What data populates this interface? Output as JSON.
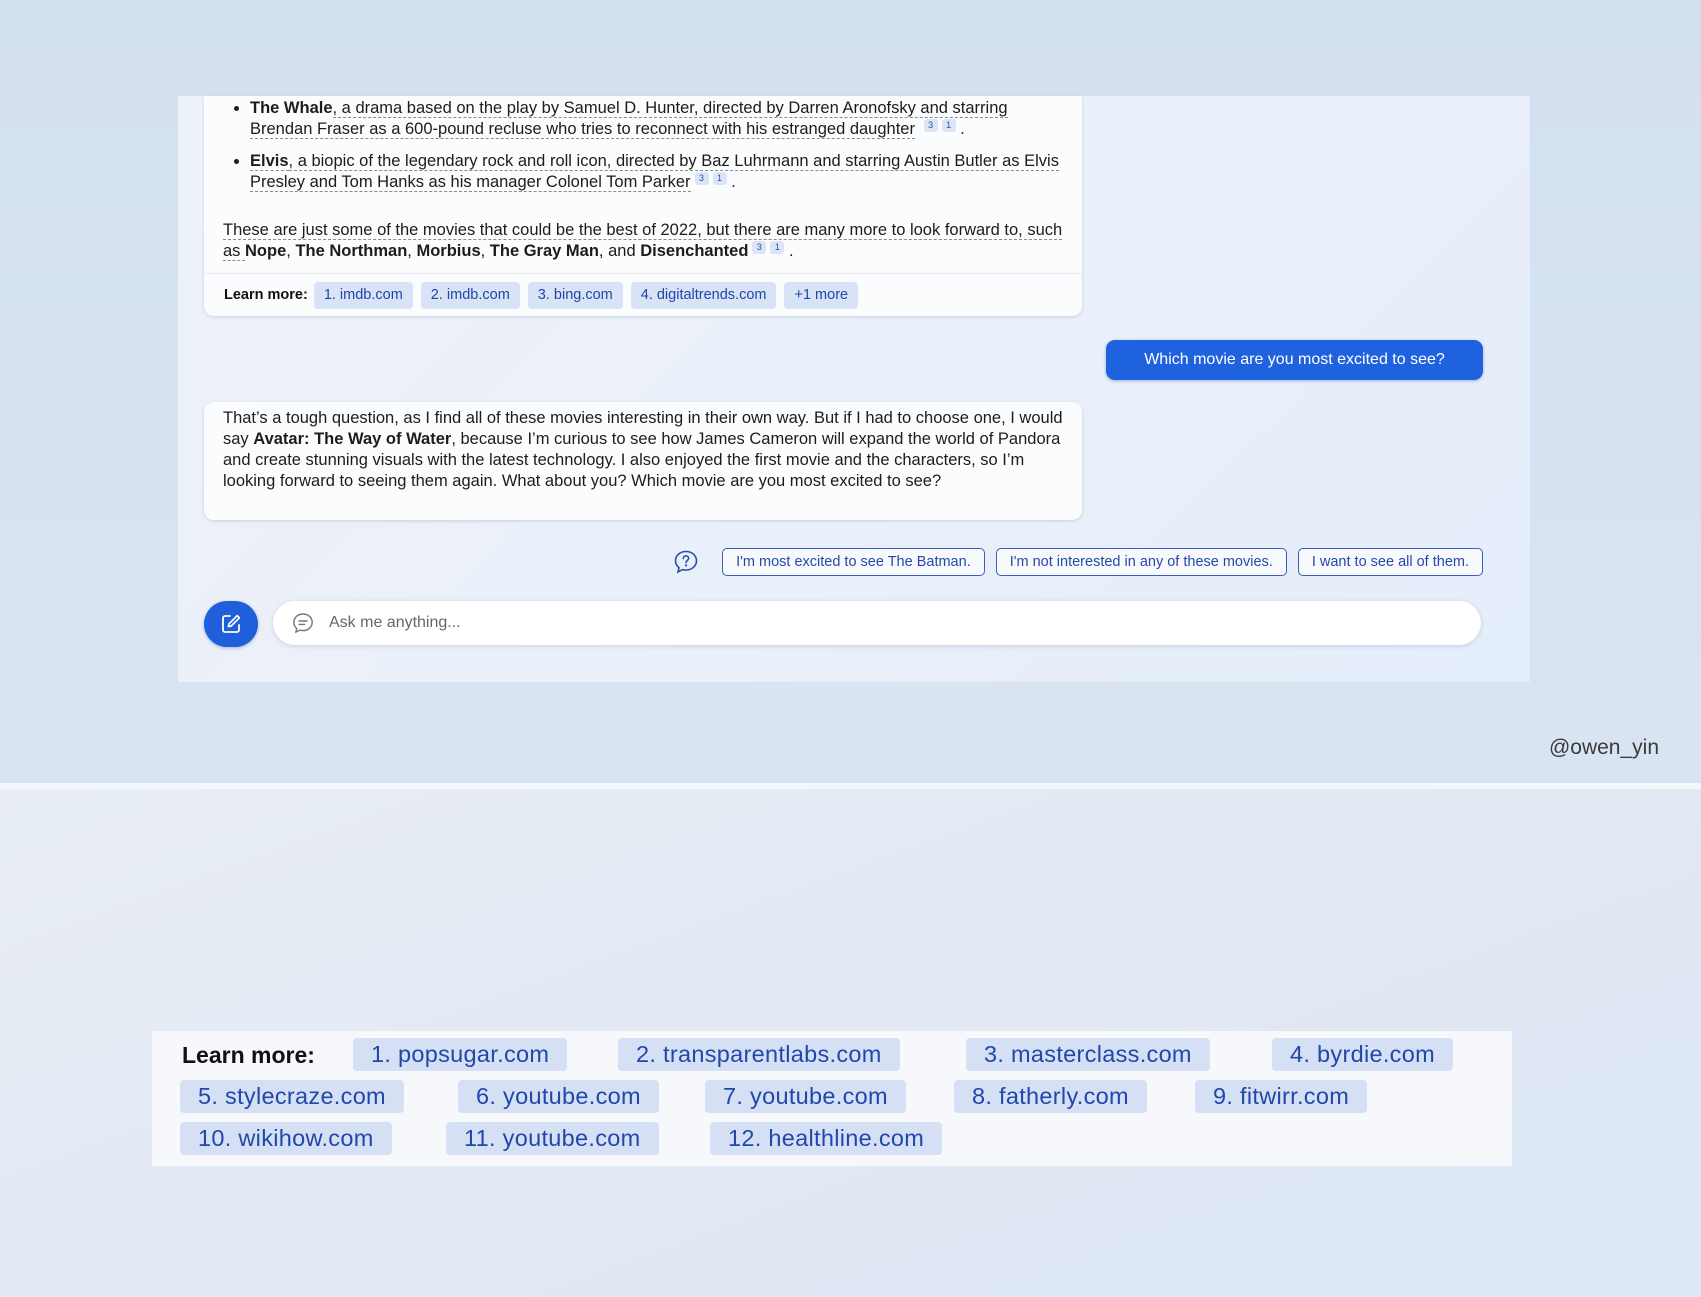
{
  "response1": {
    "bullets": [
      {
        "title": "The Whale",
        "text": ", a drama based on the play by Samuel D. Hunter, directed by Darren Aronofsky and starring Brendan Fraser as a 600-pound recluse who tries to reconnect with his estranged daughter",
        "cites": [
          "3",
          "1"
        ]
      },
      {
        "title": "Elvis",
        "text": ", a biopic of the legendary rock and roll icon, directed by Baz Luhrmann and starring Austin Butler as Elvis Presley and Tom Hanks as his manager Colonel Tom Parker",
        "cites": [
          "3",
          "1"
        ]
      }
    ],
    "closing": {
      "text": "These are just some of the movies that could be the best of 2022, but there are many more to look forward to, such as ",
      "m1": "Nope",
      "m2": "The Northman",
      "m3": "Morbius",
      "m4": "The Gray Man",
      "and": ", and ",
      "m5": "Disenchanted",
      "cites": [
        "3",
        "1"
      ]
    },
    "learn_more_label": "Learn more:",
    "sources": [
      "1. imdb.com",
      "2. imdb.com",
      "3. bing.com",
      "4. digitaltrends.com",
      "+1 more"
    ]
  },
  "user_message": "Which movie are you most excited to see?",
  "response2": {
    "part1": "That’s a tough question, as I find all of these movies interesting in their own way. But if I had to choose one, I would say ",
    "bold": "Avatar: The Way of Water",
    "part2": ", because I’m curious to see how James Cameron will expand the world of Pandora and create stunning visuals with the latest technology. I also enjoyed the first movie and the characters, so I’m looking forward to seeing them again. What about you? Which movie are you most excited to see?"
  },
  "suggestions": [
    "I'm most excited to see The Batman.",
    "I'm not interested in any of these movies.",
    "I want to see all of them."
  ],
  "input": {
    "placeholder": "Ask me anything..."
  },
  "watermark": "@owen_yin",
  "learn_more_big": {
    "label": "Learn more:",
    "sources": [
      "1. popsugar.com",
      "2. transparentlabs.com",
      "3. masterclass.com",
      "4. byrdie.com",
      "5. stylecraze.com",
      "6. youtube.com",
      "7. youtube.com",
      "8. fatherly.com",
      "9. fitwirr.com",
      "10. wikihow.com",
      "11. youtube.com",
      "12. healthline.com"
    ]
  },
  "colors": {
    "accent": "#1f62e0",
    "chip_bg": "#d9e3f6",
    "chip_text": "#1f47a9"
  }
}
